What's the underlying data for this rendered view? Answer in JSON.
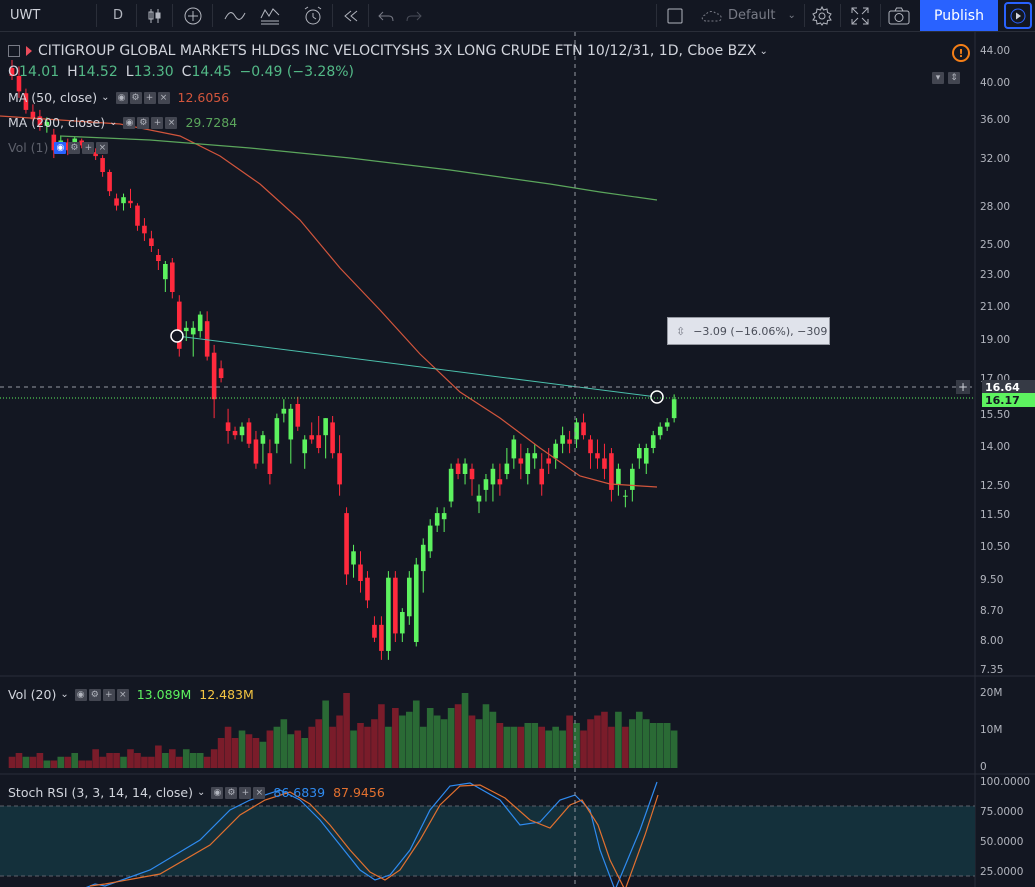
{
  "toolbar": {
    "symbol": "UWT",
    "interval": "D",
    "layout_name": "Default",
    "publish_label": "Publish"
  },
  "header": {
    "title": "CITIGROUP GLOBAL MARKETS HLDGS INC VELOCITYSHS 3X LONG CRUDE ETN 10/12/31, 1D, Cboe BZX",
    "o_label": "O",
    "o_value": "14.01",
    "h_label": "H",
    "h_value": "14.52",
    "l_label": "L",
    "l_value": "13.30",
    "c_label": "C",
    "c_value": "14.45",
    "change": "−0.49 (−3.28%)"
  },
  "indicators": {
    "ma50_label": "MA (50, close)",
    "ma50_value": "12.6056",
    "ma200_label": "MA (200, close)",
    "ma200_value": "29.7284",
    "vol_overlay_label": "Vol (1)",
    "vol_label": "Vol (20)",
    "vol_value": "13.089M",
    "vol_ma_value": "12.483M",
    "stoch_label": "Stoch RSI (3, 3, 14, 14, close)",
    "stoch_k": "86.6839",
    "stoch_d": "87.9456"
  },
  "measure": {
    "label": "−3.09 (−16.06%), −309"
  },
  "price_axis": {
    "ticks": [
      "44.00",
      "40.00",
      "36.00",
      "32.00",
      "28.00",
      "25.00",
      "23.00",
      "21.00",
      "19.00",
      "17.00",
      "15.50",
      "14.00",
      "12.50",
      "11.50",
      "10.50",
      "9.50",
      "8.70",
      "8.00",
      "7.35"
    ],
    "crosshair_price": "16.64",
    "last_price": "16.17"
  },
  "volume_axis": {
    "ticks": [
      "20M",
      "10M",
      "0"
    ]
  },
  "stoch_axis": {
    "ticks": [
      "100.0000",
      "75.0000",
      "50.0000",
      "25.0000"
    ]
  },
  "colors": {
    "up": "#53b987",
    "down": "#eb4d5c",
    "ma50": "#d2553c",
    "ma200": "#5ba65c",
    "stoch_k": "#2f8bf0",
    "stoch_d": "#e2702f",
    "trendline": "#4bbfab",
    "last_price": "#5df25f"
  },
  "chart_data": {
    "type": "candlestick",
    "ohlc": [
      [
        42.0,
        43.0,
        40.5,
        41.0
      ],
      [
        41.0,
        42.2,
        38.5,
        39.2
      ],
      [
        39.0,
        39.5,
        36.8,
        37.2
      ],
      [
        37.0,
        37.8,
        35.5,
        36.2
      ],
      [
        36.5,
        37.2,
        35.0,
        35.6
      ],
      [
        35.5,
        36.4,
        34.8,
        35.9
      ],
      [
        34.6,
        35.2,
        32.2,
        33.0
      ],
      [
        33.2,
        34.5,
        32.8,
        34.0
      ],
      [
        33.8,
        34.2,
        32.5,
        33.0
      ],
      [
        33.6,
        34.4,
        33.0,
        34.2
      ],
      [
        34.0,
        34.2,
        33.2,
        33.5
      ],
      [
        33.5,
        33.8,
        32.8,
        33.2
      ],
      [
        32.8,
        33.2,
        32.0,
        32.4
      ],
      [
        32.2,
        32.5,
        30.6,
        31.0
      ],
      [
        31.0,
        31.2,
        29.0,
        29.4
      ],
      [
        28.8,
        29.2,
        27.8,
        28.2
      ],
      [
        28.4,
        29.2,
        27.8,
        28.9
      ],
      [
        28.6,
        29.6,
        28.0,
        28.4
      ],
      [
        28.2,
        28.4,
        26.2,
        26.6
      ],
      [
        26.6,
        27.2,
        25.4,
        26.0
      ],
      [
        25.6,
        26.2,
        24.6,
        25.0
      ],
      [
        24.4,
        24.8,
        23.4,
        24.0
      ],
      [
        22.8,
        24.0,
        22.0,
        23.8
      ],
      [
        23.9,
        24.2,
        21.6,
        22.0
      ],
      [
        21.4,
        21.8,
        18.2,
        18.6
      ],
      [
        19.6,
        20.2,
        19.0,
        19.8
      ],
      [
        19.4,
        20.2,
        18.2,
        19.8
      ],
      [
        19.6,
        20.8,
        19.2,
        20.6
      ],
      [
        20.2,
        20.8,
        18.0,
        18.2
      ],
      [
        18.4,
        18.8,
        15.4,
        16.2
      ],
      [
        17.6,
        18.0,
        16.9,
        17.1
      ],
      [
        15.2,
        15.8,
        14.2,
        14.8
      ],
      [
        14.8,
        15.0,
        14.4,
        14.6
      ],
      [
        14.6,
        15.2,
        14.3,
        15.0
      ],
      [
        15.2,
        15.4,
        14.0,
        14.2
      ],
      [
        14.4,
        14.8,
        13.2,
        13.4
      ],
      [
        14.2,
        14.8,
        13.4,
        14.6
      ],
      [
        13.8,
        14.4,
        12.6,
        13.0
      ],
      [
        14.2,
        15.6,
        13.8,
        15.4
      ],
      [
        15.6,
        16.2,
        15.2,
        15.8
      ],
      [
        14.4,
        16.0,
        13.4,
        15.8
      ],
      [
        16.0,
        16.3,
        14.8,
        15.0
      ],
      [
        13.8,
        14.6,
        13.2,
        14.4
      ],
      [
        14.6,
        15.2,
        14.2,
        14.4
      ],
      [
        14.6,
        15.5,
        13.8,
        14.0
      ],
      [
        14.6,
        15.4,
        13.6,
        15.4
      ],
      [
        15.2,
        15.5,
        13.6,
        13.8
      ],
      [
        13.8,
        14.6,
        12.2,
        12.6
      ],
      [
        11.6,
        11.8,
        9.4,
        9.7
      ],
      [
        10.0,
        10.6,
        9.6,
        10.4
      ],
      [
        10.0,
        10.4,
        9.2,
        9.5
      ],
      [
        9.6,
        9.8,
        8.8,
        9.0
      ],
      [
        8.4,
        8.6,
        8.0,
        8.1
      ],
      [
        8.4,
        8.6,
        7.6,
        7.8
      ],
      [
        7.8,
        9.8,
        7.6,
        9.6
      ],
      [
        9.6,
        9.8,
        8.0,
        8.2
      ],
      [
        8.2,
        8.8,
        8.0,
        8.7
      ],
      [
        8.6,
        9.8,
        8.4,
        9.6
      ],
      [
        8.0,
        10.2,
        7.9,
        10.0
      ],
      [
        9.8,
        10.8,
        9.2,
        10.6
      ],
      [
        10.4,
        11.4,
        10.2,
        11.2
      ],
      [
        11.2,
        11.8,
        11.0,
        11.6
      ],
      [
        11.4,
        11.8,
        11.0,
        11.6
      ],
      [
        12.0,
        13.4,
        11.8,
        13.2
      ],
      [
        13.4,
        13.6,
        12.8,
        13.0
      ],
      [
        13.0,
        13.6,
        12.6,
        13.4
      ],
      [
        13.2,
        13.4,
        12.2,
        12.8
      ],
      [
        12.0,
        12.6,
        11.6,
        12.2
      ],
      [
        12.4,
        13.0,
        12.0,
        12.8
      ],
      [
        12.6,
        13.4,
        12.0,
        13.2
      ],
      [
        12.8,
        13.4,
        12.2,
        12.6
      ],
      [
        13.0,
        14.0,
        12.8,
        13.4
      ],
      [
        13.6,
        14.6,
        13.2,
        14.4
      ],
      [
        13.6,
        14.2,
        12.8,
        13.4
      ],
      [
        13.0,
        14.0,
        12.6,
        13.8
      ],
      [
        13.6,
        14.2,
        13.2,
        13.8
      ],
      [
        13.2,
        13.8,
        12.2,
        12.6
      ],
      [
        13.6,
        14.0,
        13.0,
        13.4
      ],
      [
        13.6,
        14.4,
        13.2,
        14.2
      ],
      [
        14.2,
        15.0,
        13.8,
        14.6
      ],
      [
        14.4,
        14.8,
        13.8,
        14.2
      ],
      [
        14.4,
        15.4,
        14.0,
        15.2
      ],
      [
        15.2,
        15.6,
        14.4,
        14.6
      ],
      [
        14.4,
        14.6,
        13.2,
        13.8
      ],
      [
        13.8,
        14.4,
        13.2,
        13.6
      ],
      [
        13.6,
        14.2,
        12.8,
        13.2
      ],
      [
        13.8,
        14.0,
        12.0,
        12.4
      ],
      [
        12.6,
        13.4,
        12.2,
        13.2
      ],
      [
        12.2,
        12.4,
        11.8,
        12.2
      ],
      [
        12.4,
        13.4,
        12.0,
        13.2
      ],
      [
        13.6,
        14.2,
        13.2,
        14.0
      ],
      [
        13.4,
        14.2,
        13.0,
        14.0
      ],
      [
        14.0,
        14.8,
        13.8,
        14.6
      ],
      [
        14.6,
        15.2,
        14.4,
        15.0
      ],
      [
        15.0,
        15.4,
        14.8,
        15.2
      ],
      [
        15.4,
        16.4,
        15.2,
        16.2
      ]
    ],
    "volume": [
      3,
      4,
      3,
      3,
      4,
      2,
      2,
      3,
      3,
      4,
      2,
      2,
      5,
      3,
      4,
      4,
      3,
      5,
      4,
      3,
      3,
      6,
      4,
      5,
      3,
      5,
      4,
      4,
      3,
      5,
      8,
      11,
      8,
      10,
      9,
      8,
      7,
      10,
      11,
      13,
      9,
      10,
      8,
      11,
      13,
      18,
      11,
      14,
      20,
      10,
      12,
      11,
      13,
      17,
      11,
      16,
      14,
      15,
      18,
      11,
      16,
      14,
      13,
      16,
      17,
      20,
      14,
      13,
      17,
      15,
      12,
      11,
      11,
      11,
      12,
      12,
      11,
      10,
      11,
      10,
      14,
      12,
      10,
      13,
      14,
      15,
      11,
      15,
      11,
      13,
      15,
      13,
      12,
      12,
      12,
      10
    ],
    "volume_color": [
      "d",
      "d",
      "u",
      "d",
      "d",
      "u",
      "d",
      "u",
      "d",
      "u",
      "d",
      "d",
      "d",
      "d",
      "d",
      "d",
      "u",
      "d",
      "d",
      "d",
      "d",
      "d",
      "u",
      "d",
      "d",
      "u",
      "u",
      "u",
      "d",
      "d",
      "d",
      "d",
      "d",
      "u",
      "d",
      "d",
      "u",
      "d",
      "u",
      "u",
      "u",
      "d",
      "u",
      "d",
      "d",
      "u",
      "d",
      "d",
      "d",
      "u",
      "d",
      "d",
      "d",
      "d",
      "u",
      "d",
      "u",
      "u",
      "u",
      "u",
      "u",
      "u",
      "u",
      "u",
      "d",
      "u",
      "d",
      "u",
      "u",
      "u",
      "d",
      "u",
      "u",
      "d",
      "u",
      "u",
      "d",
      "u",
      "u",
      "u",
      "d",
      "u",
      "d",
      "d",
      "d",
      "d",
      "d",
      "u",
      "d",
      "u",
      "u",
      "u",
      "u",
      "u",
      "u",
      "u"
    ],
    "ma50": [
      null,
      null,
      null,
      null,
      null,
      null,
      null,
      null,
      null,
      null,
      null,
      null,
      null,
      null,
      null,
      null,
      null,
      null,
      null,
      null,
      null,
      null,
      null,
      null,
      null,
      null,
      null,
      null,
      null,
      null,
      null,
      null,
      null,
      null,
      null,
      null,
      null,
      null,
      null,
      null,
      null,
      null,
      null,
      null,
      null,
      null,
      null,
      null,
      null,
      null,
      null,
      null,
      null,
      null,
      null,
      null,
      null,
      null,
      null,
      null,
      null,
      null,
      null,
      null,
      null,
      null,
      null,
      null,
      null,
      null,
      null,
      null,
      null,
      null,
      null,
      null,
      null,
      null,
      null,
      null,
      null,
      null,
      null,
      null,
      null,
      null,
      null,
      null,
      null,
      null,
      null,
      null,
      null,
      null,
      null,
      null
    ],
    "xlabel": "",
    "ylabel": ""
  }
}
